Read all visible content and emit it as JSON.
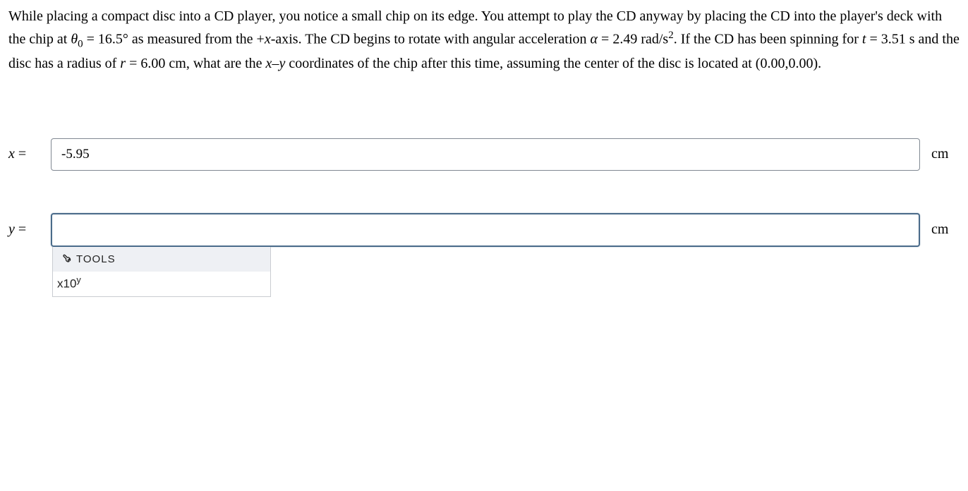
{
  "question": {
    "line1_a": "While placing a compact disc into a CD player, you notice a small chip on its edge. You attempt to play the CD anyway by",
    "line2_a": "placing the CD into the player's deck with the chip at ",
    "theta_sym": "θ",
    "theta_sub": "0",
    "eq": " = ",
    "theta_val": "16.5°",
    "line2_b": " as measured from the +",
    "x_axis": "x",
    "line2_c": "-axis. The CD begins to rotate",
    "line3_a": "with angular acceleration ",
    "alpha_sym": "α",
    "alpha_val": "2.49 rad/s",
    "sq": "2",
    "line3_b": ". If the CD has been spinning for ",
    "t_sym": "t",
    "t_val": "3.51 s",
    "line3_c": " and the disc has a radius of",
    "line4_a": "",
    "r_sym": "r",
    "r_val": "6.00 cm",
    "line4_b": ", what are the ",
    "xy_x": "x",
    "dash": "–",
    "xy_y": "y",
    "line4_c": " coordinates of the chip after this time, assuming the center of the disc is located at",
    "line5": "(0.00,0.00)."
  },
  "answers": {
    "x": {
      "label": "x",
      "eq": " = ",
      "value": "-5.95",
      "unit": "cm"
    },
    "y": {
      "label": "y",
      "eq": " = ",
      "value": "",
      "unit": "cm"
    }
  },
  "tools": {
    "header": "TOOLS",
    "button_base": "x10",
    "button_sup": "y"
  }
}
